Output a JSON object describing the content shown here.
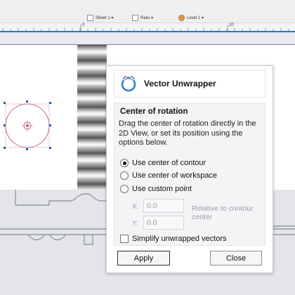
{
  "toolbar": {
    "sheet": "Sheet 1 ▾",
    "rails": "Rails ▾",
    "level": "Level 1 ▾"
  },
  "ruler": {
    "mark1": "0",
    "mark2": "20"
  },
  "dialog": {
    "title": "Vector Unwrapper",
    "section_title": "Center of rotation",
    "description": "Drag the center of rotation directly in the 2D View, or set its position using the options below.",
    "options": [
      {
        "label": "Use center of contour",
        "selected": true
      },
      {
        "label": "Use center of workspace",
        "selected": false
      },
      {
        "label": "Use custom point",
        "selected": false
      }
    ],
    "x_label": "X:",
    "y_label": "Y:",
    "x_value": "0.0",
    "y_value": "0.0",
    "hint": "Relative to contour center",
    "simplify_label": "Simplify unwrapped vectors",
    "apply_label": "Apply",
    "close_label": "Close"
  }
}
